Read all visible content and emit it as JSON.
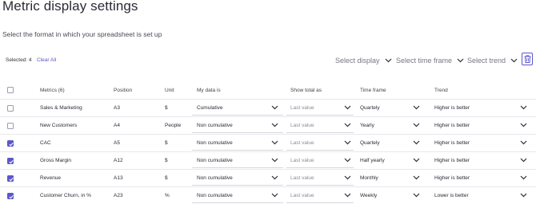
{
  "header": {
    "title": "Metric display settings",
    "subtitle": "Select the format in which your spreadsheet is set up"
  },
  "toolbar": {
    "selected_label": "Selected: 4",
    "clear_all_label": "Clear All",
    "filters": [
      "Select display",
      "Select time frame",
      "Select trend"
    ],
    "delete_icon": "trash-icon"
  },
  "table": {
    "columns": [
      "Metrics (6)",
      "Position",
      "Unit",
      "My data is",
      "Show total as",
      "Time frame",
      "Trend"
    ],
    "rows": [
      {
        "checked": false,
        "metric": "Sales & Marketing",
        "position": "A3",
        "unit": "$",
        "data": "Cumulative",
        "total": "Last value",
        "timeframe": "Quartely",
        "trend": "Higher is better"
      },
      {
        "checked": false,
        "metric": "New Customers",
        "position": "A4",
        "unit": "People",
        "data": "Non cumulative",
        "total": "Last value",
        "timeframe": "Yearly",
        "trend": "Higher is better"
      },
      {
        "checked": true,
        "metric": "CAC",
        "position": "A5",
        "unit": "$",
        "data": "Non cumulative",
        "total": "Last value",
        "timeframe": "Quartely",
        "trend": "Higher is better"
      },
      {
        "checked": true,
        "metric": "Gross Margin",
        "position": "A12",
        "unit": "$",
        "data": "Non cumulative",
        "total": "Last value",
        "timeframe": "Half yearly",
        "trend": "Higher is better"
      },
      {
        "checked": true,
        "metric": "Revenue",
        "position": "A13",
        "unit": "$",
        "data": "Non cumulative",
        "total": "Last value",
        "timeframe": "Monthly",
        "trend": "Higher is better"
      },
      {
        "checked": true,
        "metric": "Customer Churn, in %",
        "position": "A23",
        "unit": "%",
        "data": "Non cumulative",
        "total": "Last value",
        "timeframe": "Weekly",
        "trend": "Lower is better"
      }
    ]
  },
  "colors": {
    "accent": "#5b57c9",
    "text": "#2b2b36",
    "muted": "#8a8a96",
    "divider": "#e8e8ee"
  }
}
